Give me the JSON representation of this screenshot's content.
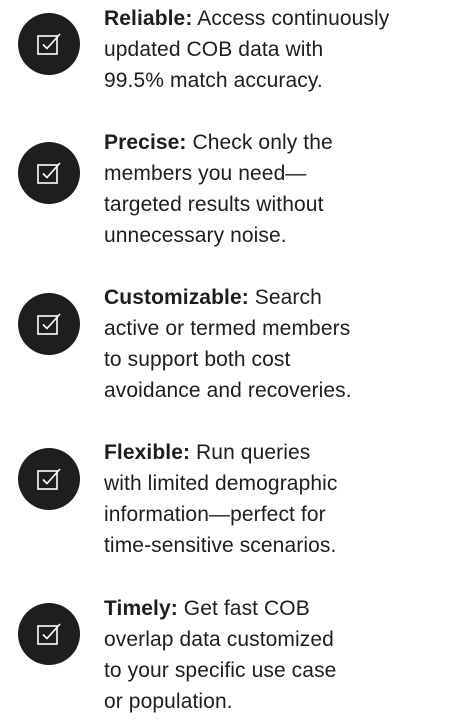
{
  "colors": {
    "badge": "#1e1e1e",
    "icon_stroke": "#ffffff",
    "text": "#1e1e1e"
  },
  "items": [
    {
      "icon": "checkbox-icon",
      "title": "Reliable:",
      "lines": [
        "Access continuously",
        "updated COB data with",
        "99.5% match accuracy."
      ]
    },
    {
      "icon": "checkbox-icon",
      "title": "Precise:",
      "lines": [
        "Check only the",
        "members you need—",
        "targeted results without",
        "unnecessary noise."
      ]
    },
    {
      "icon": "checkbox-icon",
      "title": "Customizable:",
      "lines": [
        "Search",
        "active or termed members",
        "to support both cost",
        "avoidance and recoveries."
      ]
    },
    {
      "icon": "checkbox-icon",
      "title": "Flexible:",
      "lines": [
        "Run queries",
        "with limited demographic",
        "information—perfect for",
        "time-sensitive scenarios."
      ]
    },
    {
      "icon": "checkbox-icon",
      "title": "Timely:",
      "lines": [
        "Get fast COB",
        "overlap data customized",
        "to your specific use case",
        "or population."
      ]
    }
  ]
}
